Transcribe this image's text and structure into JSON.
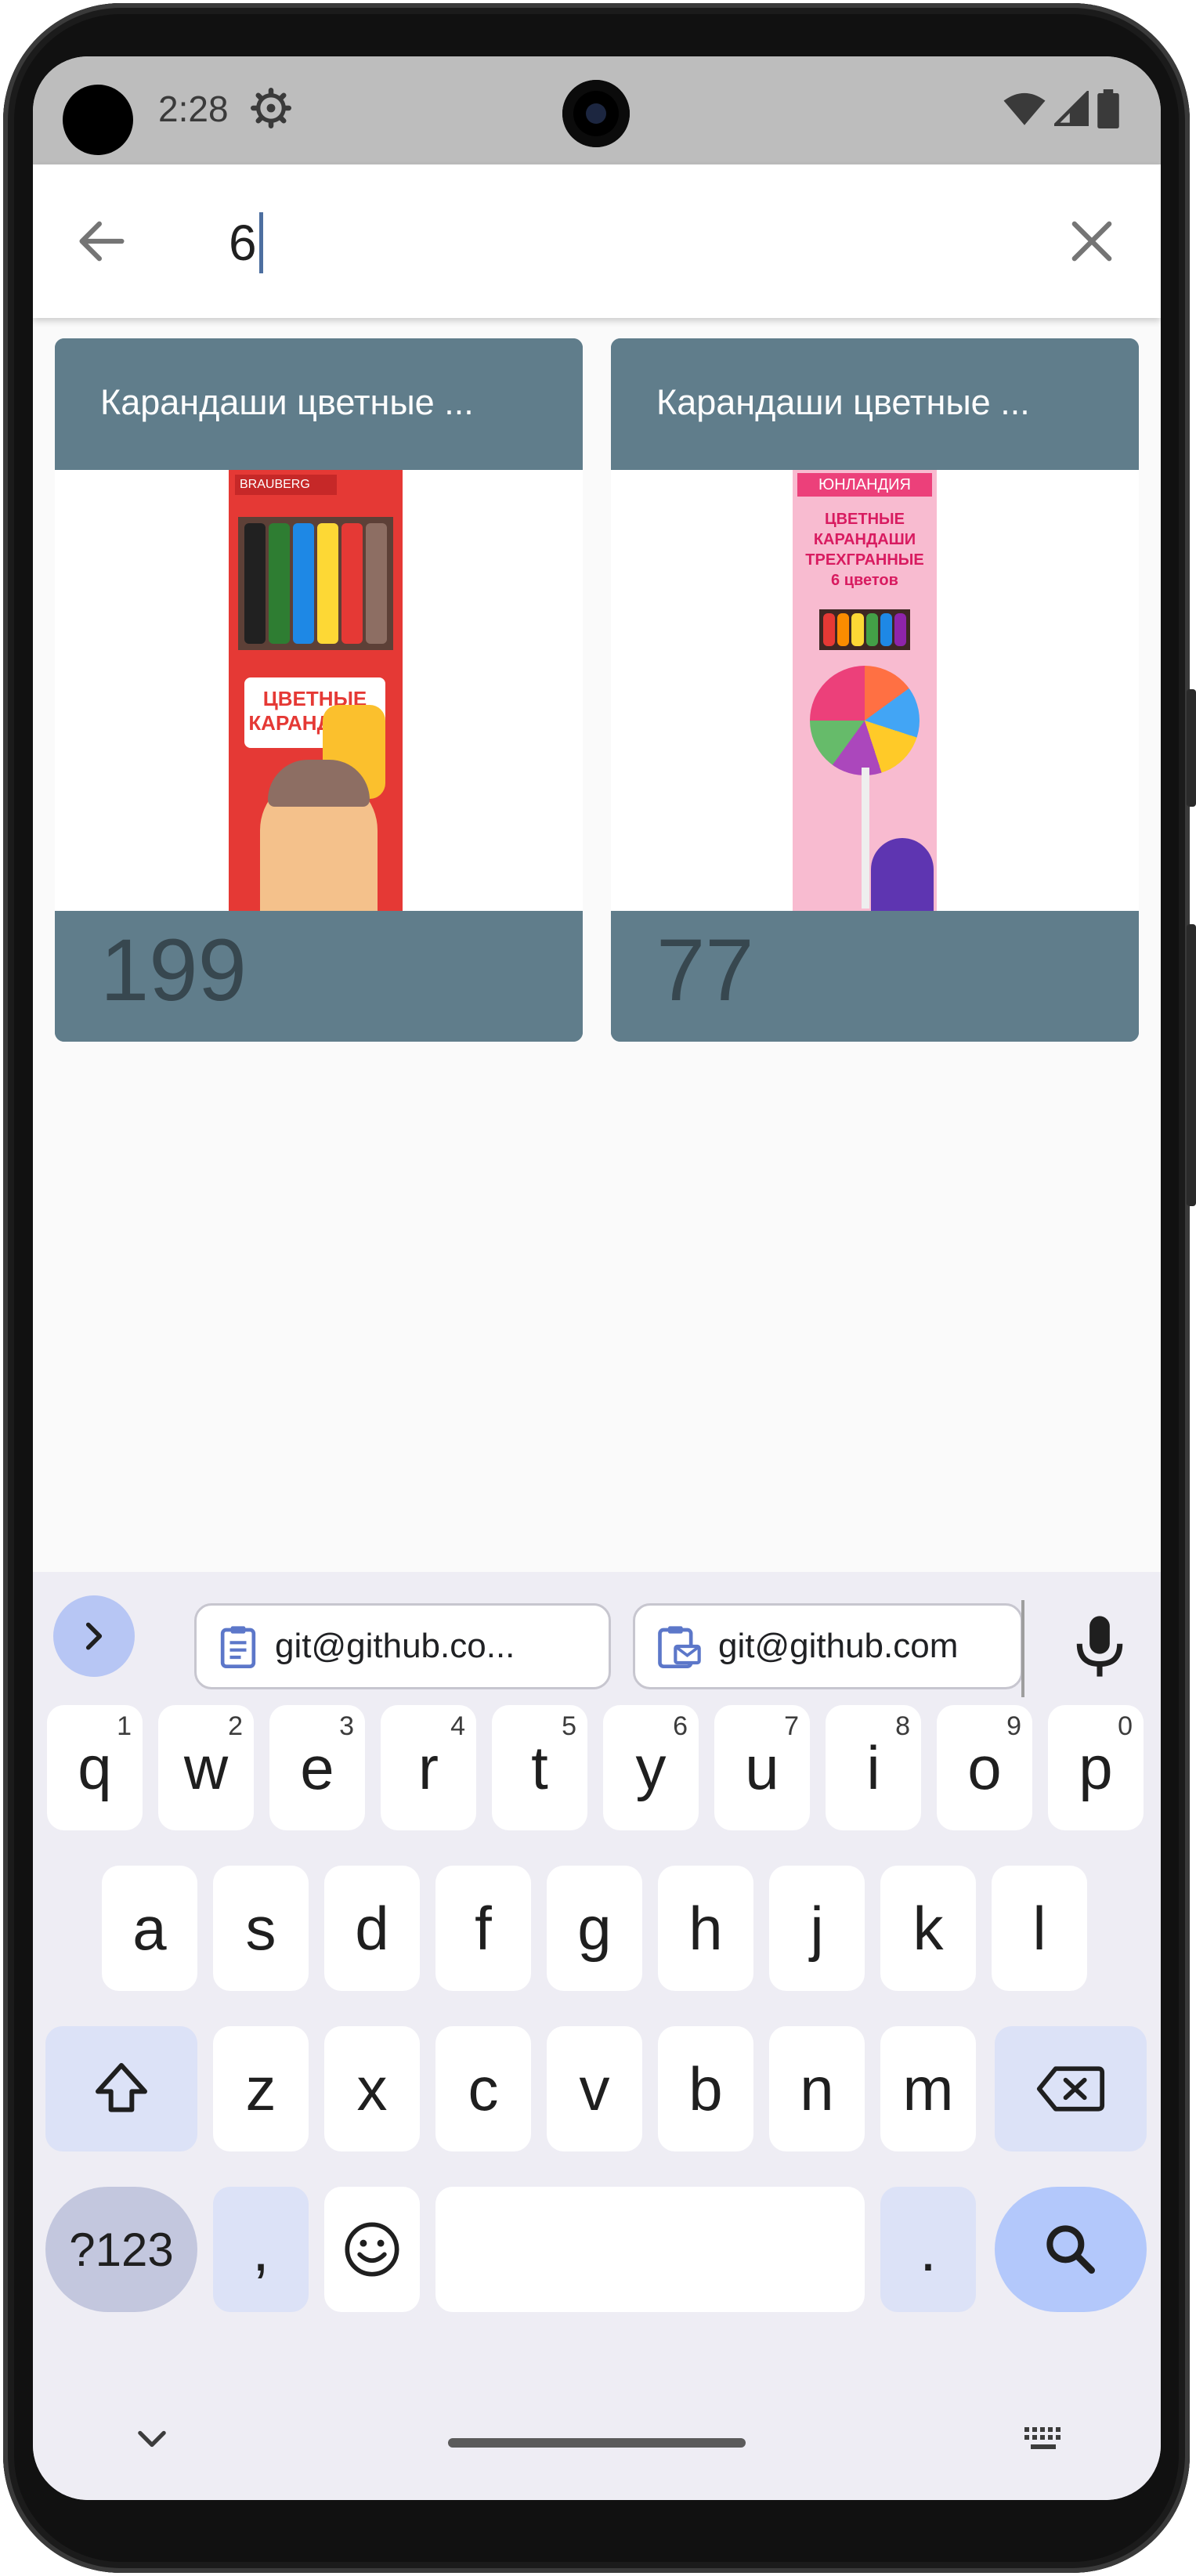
{
  "status_bar": {
    "time": "2:28",
    "icons": [
      "settings-gear-icon",
      "wifi-icon",
      "signal-icon",
      "battery-icon"
    ]
  },
  "search": {
    "value": "6",
    "back_icon": "arrow-left-icon",
    "clear_icon": "close-icon"
  },
  "products": [
    {
      "title": "Карандаши цветные ...",
      "price": "199",
      "brand": "BRAUBERG",
      "box_label": "ЦВЕТНЫЕ КАРАНДАШИ"
    },
    {
      "title": "Карандаши цветные ...",
      "price": "77",
      "brand": "ЮНЛАНДИЯ",
      "box_label": "ЦВЕТНЫЕ КАРАНДАШИ ТРЕХГРАННЫЕ 6 цветов"
    }
  ],
  "keyboard": {
    "suggestions": [
      "git@github.co...",
      "git@github.com"
    ],
    "row1": [
      {
        "key": "q",
        "hint": "1"
      },
      {
        "key": "w",
        "hint": "2"
      },
      {
        "key": "e",
        "hint": "3"
      },
      {
        "key": "r",
        "hint": "4"
      },
      {
        "key": "t",
        "hint": "5"
      },
      {
        "key": "y",
        "hint": "6"
      },
      {
        "key": "u",
        "hint": "7"
      },
      {
        "key": "i",
        "hint": "8"
      },
      {
        "key": "o",
        "hint": "9"
      },
      {
        "key": "p",
        "hint": "0"
      }
    ],
    "row2": [
      "a",
      "s",
      "d",
      "f",
      "g",
      "h",
      "j",
      "k",
      "l"
    ],
    "row3": [
      "z",
      "x",
      "c",
      "v",
      "b",
      "n",
      "m"
    ],
    "symbols_label": "?123",
    "comma_label": ",",
    "period_label": "."
  },
  "colors": {
    "card_bar": "#607d8b",
    "price_text": "#37474f",
    "keyboard_bg": "#eeedf4",
    "accent": "#b3c8fb"
  }
}
